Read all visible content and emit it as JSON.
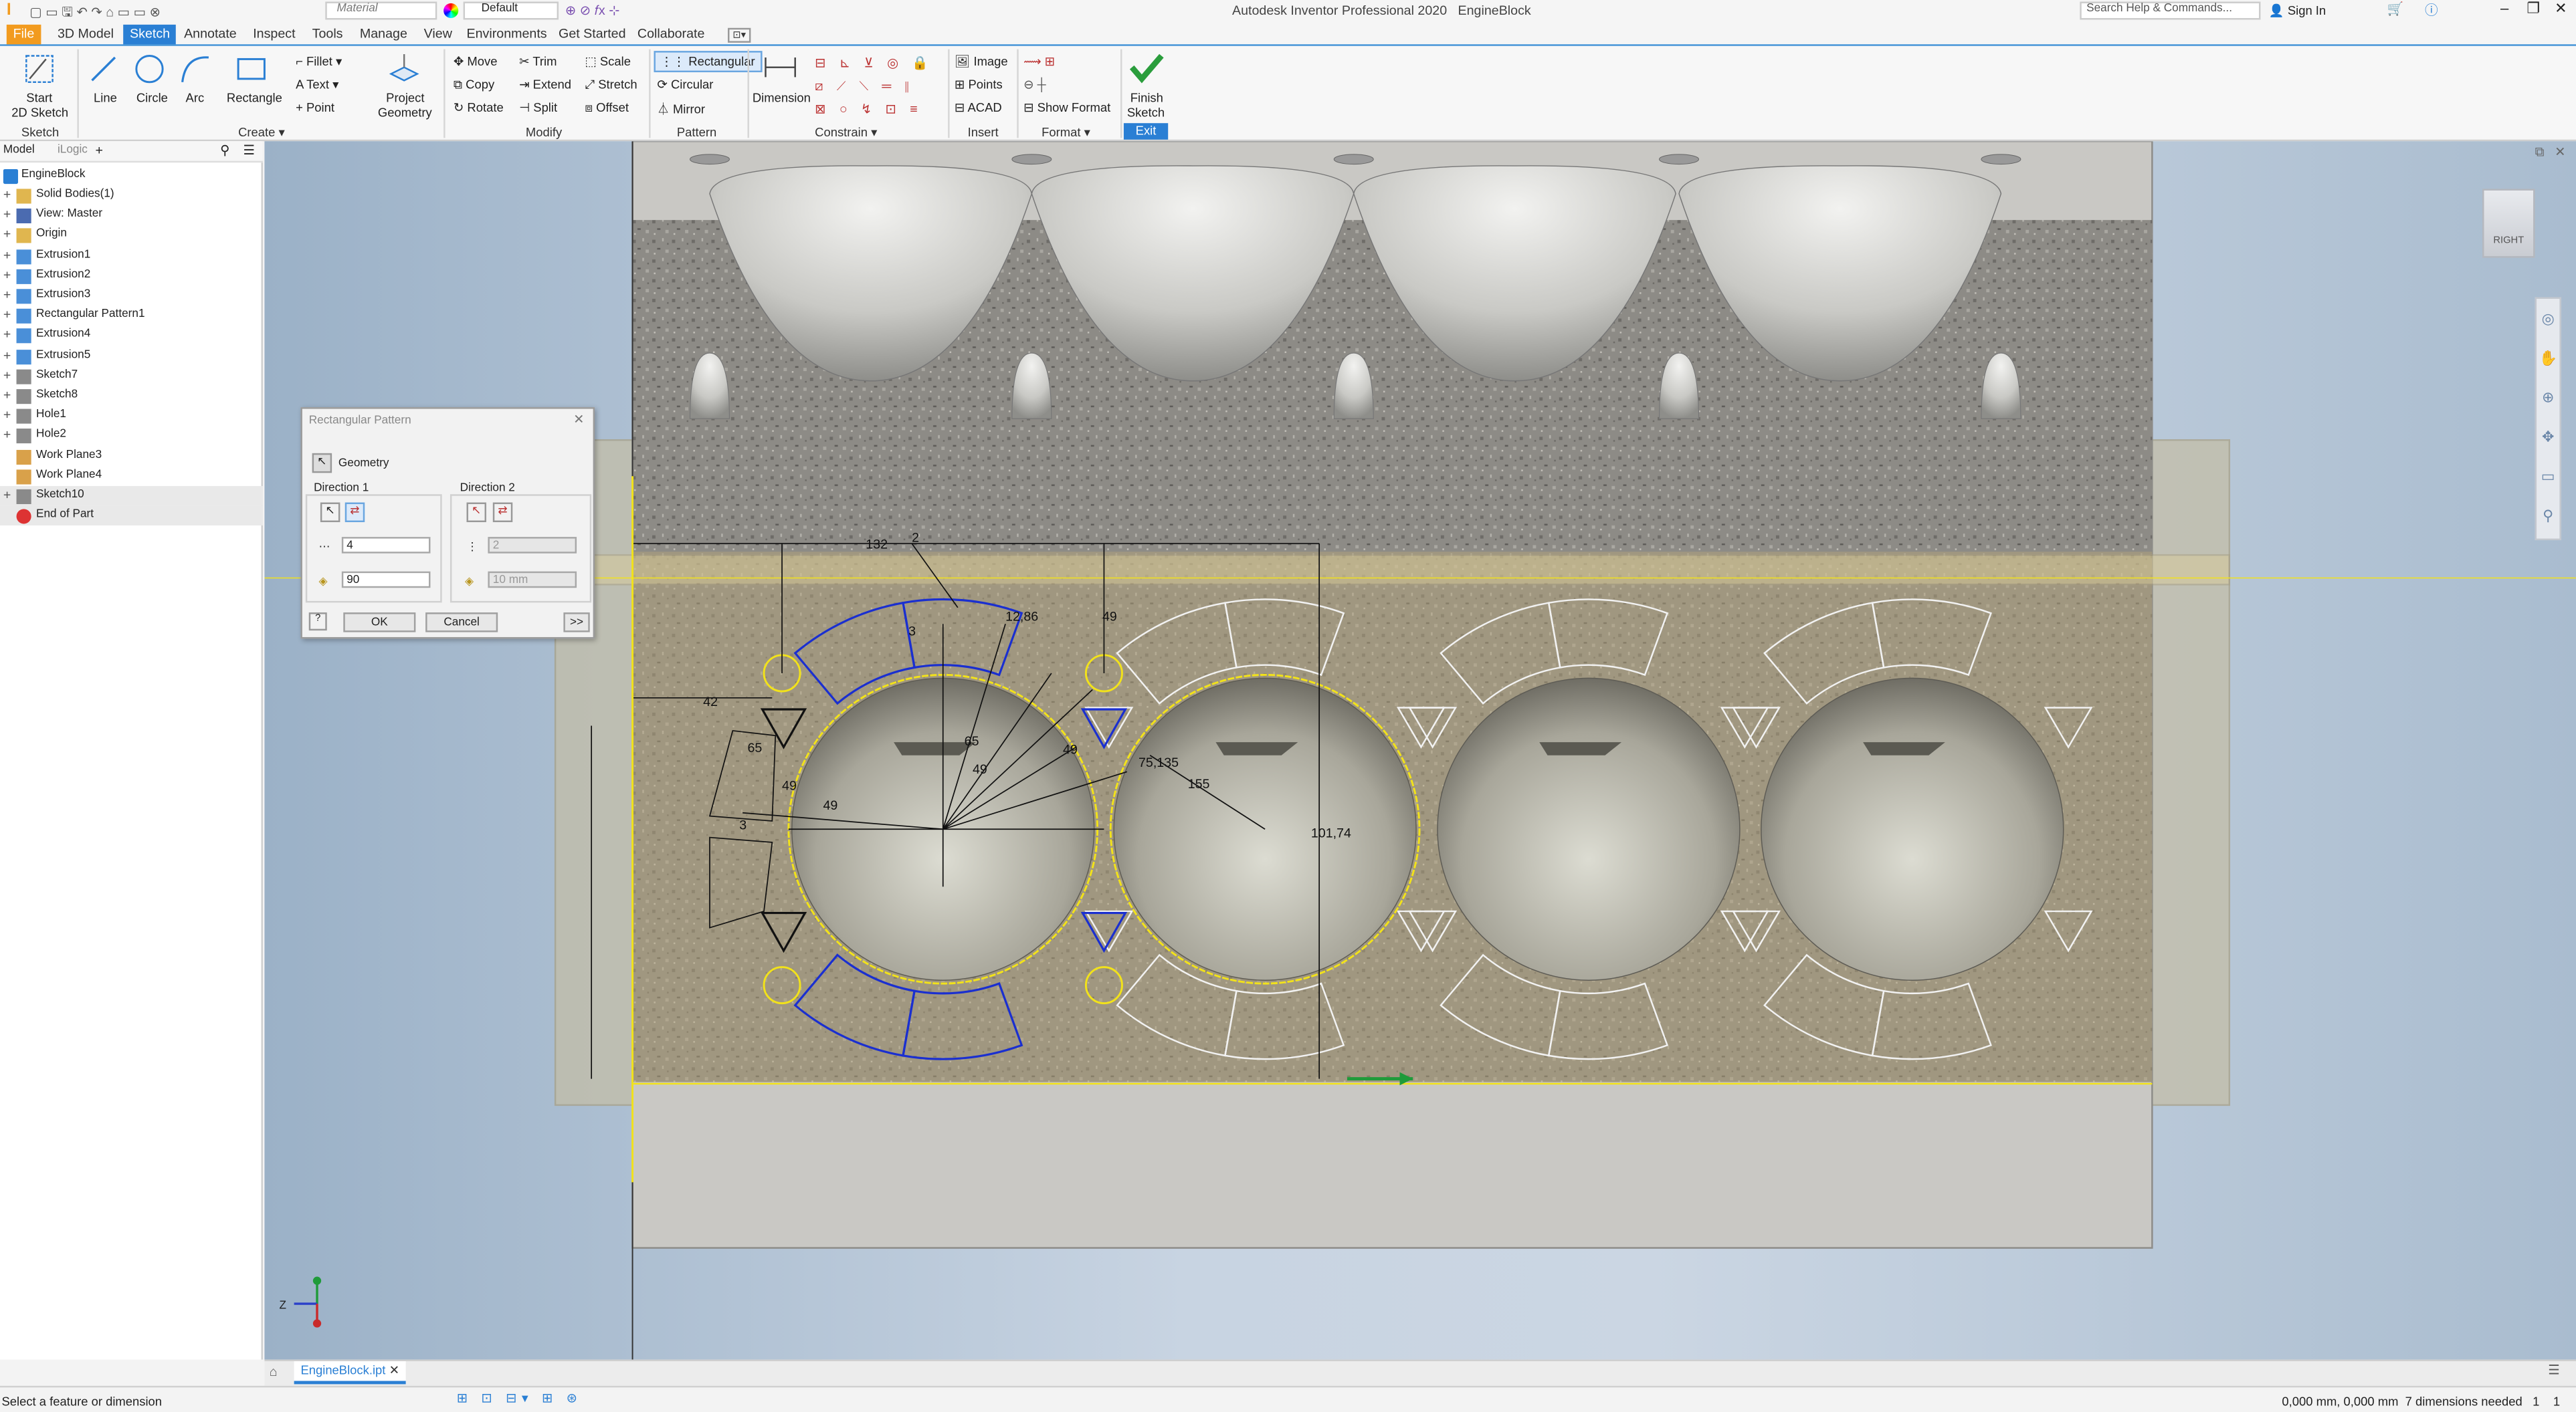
{
  "window": {
    "title": "Autodesk Inventor Professional 2020",
    "doc": "EngineBlock",
    "search_placeholder": "Search Help & Commands...",
    "sign_in": "Sign In",
    "material": "Material",
    "appearance": "Default"
  },
  "menu": [
    "File",
    "3D Model",
    "Sketch",
    "Annotate",
    "Inspect",
    "Tools",
    "Manage",
    "View",
    "Environments",
    "Get Started",
    "Collaborate"
  ],
  "ribbon": {
    "start_sketch": "Start",
    "start_sketch2": "2D Sketch",
    "line": "Line",
    "circle": "Circle",
    "arc": "Arc",
    "rectangle": "Rectangle",
    "fillet": "Fillet",
    "text": "Text",
    "point": "Point",
    "project": "Project",
    "geometry": "Geometry",
    "move": "Move",
    "copy": "Copy",
    "rotate": "Rotate",
    "trim": "Trim",
    "extend": "Extend",
    "split": "Split",
    "scale": "Scale",
    "stretch": "Stretch",
    "offset": "Offset",
    "rectangular": "Rectangular",
    "circular": "Circular",
    "mirror": "Mirror",
    "dimension": "Dimension",
    "image": "Image",
    "points": "Points",
    "acad": "ACAD",
    "show_format": "Show Format",
    "finish": "Finish",
    "finish2": "Sketch",
    "exit": "Exit",
    "groups": {
      "sketch": "Sketch",
      "create": "Create",
      "modify": "Modify",
      "pattern": "Pattern",
      "constrain": "Constrain",
      "insert": "Insert",
      "format": "Format"
    }
  },
  "browser": {
    "tab_model": "Model",
    "tab_ilogic": "iLogic",
    "root": "EngineBlock",
    "items": [
      "Solid Bodies(1)",
      "View: Master",
      "Origin",
      "Extrusion1",
      "Extrusion2",
      "Extrusion3",
      "Rectangular Pattern1",
      "Extrusion4",
      "Extrusion5",
      "Sketch7",
      "Sketch8",
      "Hole1",
      "Hole2",
      "Work Plane3",
      "Work Plane4",
      "Sketch10",
      "End of Part"
    ]
  },
  "dialog": {
    "title": "Rectangular Pattern",
    "geometry": "Geometry",
    "dir1": "Direction 1",
    "dir2": "Direction 2",
    "count1": "4",
    "spacing1": "90",
    "count2": "2",
    "spacing2": "10 mm",
    "ok": "OK",
    "cancel": "Cancel",
    "more": ">>"
  },
  "dims": [
    "132",
    "2",
    "3",
    "49",
    "65",
    "49",
    "12,86",
    "65",
    "49",
    "42",
    "3",
    "49",
    "49",
    "75,135",
    "155",
    "101,74"
  ],
  "viewcube": "RIGHT",
  "tab": {
    "file": "EngineBlock.ipt"
  },
  "status": {
    "left": "Select a feature or dimension",
    "right": "0,000 mm, 0,000 mm  7 dimensions needed   1    1"
  },
  "colors": {
    "accent": "#2a7fd4",
    "file": "#f29b1f",
    "sketch_blue": "#1a2fd0",
    "sketch_yellow": "#f2e21a"
  }
}
